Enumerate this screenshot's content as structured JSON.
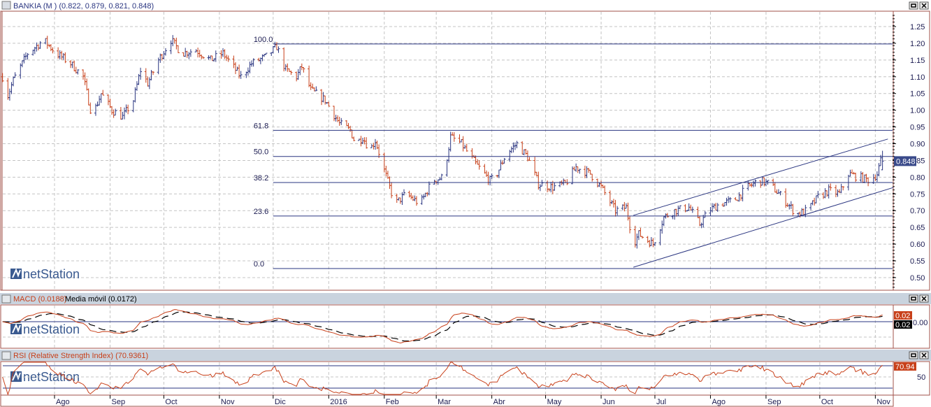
{
  "main_panel": {
    "title": "BANKIA (M ) (0.822, 0.879, 0.821, 0.848)",
    "last_price_tag": "0.848",
    "watermark": "netStation"
  },
  "macd_panel": {
    "title": "MACD (0.0188)",
    "separator": " - ",
    "signal_title": "Media móvil (0.0172)",
    "tag_macd": "0.02",
    "tag_signal": "0.02",
    "axis_label": "0.00",
    "watermark": "netStation"
  },
  "rsi_panel": {
    "title": "RSI (Relative Strength Index) (70.9361)",
    "tag": "70.94",
    "axis_label": "50",
    "watermark": "netStation"
  },
  "colors": {
    "up": "#2a3580",
    "down": "#c8401a",
    "macd": "#c8401a",
    "signal": "#000000",
    "rsi": "#c8401a",
    "border": "#a0504a",
    "header": "#c9d3de",
    "line": "#2a3580"
  },
  "chart_data": {
    "type": "ohlc",
    "y_ticks": [
      "1.25",
      "1.20",
      "1.15",
      "1.10",
      "1.05",
      "1.00",
      "0.95",
      "0.90",
      "0.85",
      "0.80",
      "0.75",
      "0.70",
      "0.65",
      "0.60",
      "0.55",
      "0.50"
    ],
    "ylim": [
      0.475,
      1.28
    ],
    "grid": true,
    "x_ticks": [
      {
        "date": "2015-08-01",
        "label": "Ago"
      },
      {
        "date": "2015-09-01",
        "label": "Sep"
      },
      {
        "date": "2015-10-01",
        "label": "Oct"
      },
      {
        "date": "2015-11-01",
        "label": "Nov"
      },
      {
        "date": "2015-12-01",
        "label": "Dic"
      },
      {
        "date": "2016-01-01",
        "label": "2016"
      },
      {
        "date": "2016-02-01",
        "label": "Feb"
      },
      {
        "date": "2016-03-01",
        "label": "Mar"
      },
      {
        "date": "2016-04-01",
        "label": "Abr"
      },
      {
        "date": "2016-05-01",
        "label": "May"
      },
      {
        "date": "2016-06-01",
        "label": "Jun"
      },
      {
        "date": "2016-07-01",
        "label": "Jul"
      },
      {
        "date": "2016-08-01",
        "label": "Ago"
      },
      {
        "date": "2016-09-01",
        "label": "Sep"
      },
      {
        "date": "2016-10-01",
        "label": "Oct"
      },
      {
        "date": "2016-11-01",
        "label": "Nov"
      }
    ],
    "last_bar": {
      "open": 0.822,
      "high": 0.879,
      "low": 0.821,
      "close": 0.848
    },
    "close_path": [
      [
        "2015-07-03",
        1.1
      ],
      [
        "2015-07-05",
        1.03
      ],
      [
        "2015-07-09",
        1.09
      ],
      [
        "2015-07-17",
        1.17
      ],
      [
        "2015-07-26",
        1.21
      ],
      [
        "2015-08-02",
        1.17
      ],
      [
        "2015-08-10",
        1.14
      ],
      [
        "2015-08-17",
        1.1
      ],
      [
        "2015-08-22",
        0.98
      ],
      [
        "2015-08-27",
        1.05
      ],
      [
        "2015-09-02",
        1.0
      ],
      [
        "2015-09-08",
        0.98
      ],
      [
        "2015-09-14",
        1.03
      ],
      [
        "2015-09-18",
        1.12
      ],
      [
        "2015-09-22",
        1.08
      ],
      [
        "2015-09-28",
        1.15
      ],
      [
        "2015-10-05",
        1.21
      ],
      [
        "2015-10-11",
        1.17
      ],
      [
        "2015-10-19",
        1.18
      ],
      [
        "2015-10-27",
        1.15
      ],
      [
        "2015-11-03",
        1.17
      ],
      [
        "2015-11-13",
        1.1
      ],
      [
        "2015-11-19",
        1.14
      ],
      [
        "2015-11-27",
        1.16
      ],
      [
        "2015-12-03",
        1.19
      ],
      [
        "2015-12-08",
        1.12
      ],
      [
        "2015-12-14",
        1.1
      ],
      [
        "2015-12-17",
        1.13
      ],
      [
        "2015-12-22",
        1.06
      ],
      [
        "2015-12-30",
        1.03
      ],
      [
        "2016-01-07",
        0.96
      ],
      [
        "2016-01-13",
        0.94
      ],
      [
        "2016-01-16",
        0.9
      ],
      [
        "2016-01-20",
        0.92
      ],
      [
        "2016-01-24",
        0.88
      ],
      [
        "2016-01-27",
        0.91
      ],
      [
        "2016-02-01",
        0.82
      ],
      [
        "2016-02-07",
        0.72
      ],
      [
        "2016-02-13",
        0.75
      ],
      [
        "2016-02-21",
        0.72
      ],
      [
        "2016-02-28",
        0.79
      ],
      [
        "2016-03-05",
        0.8
      ],
      [
        "2016-03-09",
        0.92
      ],
      [
        "2016-03-15",
        0.9
      ],
      [
        "2016-03-23",
        0.84
      ],
      [
        "2016-03-31",
        0.79
      ],
      [
        "2016-04-03",
        0.8
      ],
      [
        "2016-04-09",
        0.87
      ],
      [
        "2016-04-15",
        0.9
      ],
      [
        "2016-04-21",
        0.86
      ],
      [
        "2016-04-27",
        0.78
      ],
      [
        "2016-05-05",
        0.77
      ],
      [
        "2016-05-12",
        0.78
      ],
      [
        "2016-05-18",
        0.83
      ],
      [
        "2016-05-26",
        0.81
      ],
      [
        "2016-06-01",
        0.77
      ],
      [
        "2016-06-09",
        0.7
      ],
      [
        "2016-06-15",
        0.71
      ],
      [
        "2016-06-19",
        0.6
      ],
      [
        "2016-06-22",
        0.63
      ],
      [
        "2016-06-30",
        0.6
      ],
      [
        "2016-07-06",
        0.68
      ],
      [
        "2016-07-12",
        0.7
      ],
      [
        "2016-07-20",
        0.71
      ],
      [
        "2016-07-26",
        0.66
      ],
      [
        "2016-07-31",
        0.7
      ],
      [
        "2016-08-06",
        0.72
      ],
      [
        "2016-08-14",
        0.73
      ],
      [
        "2016-08-22",
        0.77
      ],
      [
        "2016-08-28",
        0.79
      ],
      [
        "2016-09-03",
        0.78
      ],
      [
        "2016-09-10",
        0.74
      ],
      [
        "2016-09-18",
        0.69
      ],
      [
        "2016-09-24",
        0.7
      ],
      [
        "2016-09-30",
        0.74
      ],
      [
        "2016-10-06",
        0.76
      ],
      [
        "2016-10-12",
        0.75
      ],
      [
        "2016-10-17",
        0.81
      ],
      [
        "2016-10-23",
        0.8
      ],
      [
        "2016-10-29",
        0.79
      ],
      [
        "2016-11-02",
        0.81
      ],
      [
        "2016-11-04",
        0.848
      ]
    ],
    "fibonacci": {
      "start": "2015-12-01",
      "levels": [
        {
          "label": "100.0",
          "price": 1.198
        },
        {
          "label": "61.8",
          "price": 0.94
        },
        {
          "label": "50.0",
          "price": 0.862
        },
        {
          "label": "38.2",
          "price": 0.784
        },
        {
          "label": "23.6",
          "price": 0.684
        },
        {
          "label": "0.0",
          "price": 0.527
        }
      ]
    },
    "channel": [
      {
        "from": [
          "2016-06-19",
          0.686
        ],
        "to": [
          "2016-11-08",
          0.914
        ]
      },
      {
        "from": [
          "2016-06-19",
          0.531
        ],
        "to": [
          "2016-11-11",
          0.769
        ]
      }
    ],
    "macd": {
      "fast": 12,
      "slow": 26,
      "signal": 9,
      "value": 0.0188,
      "signal_value": 0.0172
    },
    "rsi": {
      "period": 14,
      "value": 70.9361,
      "levels": [
        70,
        30
      ]
    }
  }
}
